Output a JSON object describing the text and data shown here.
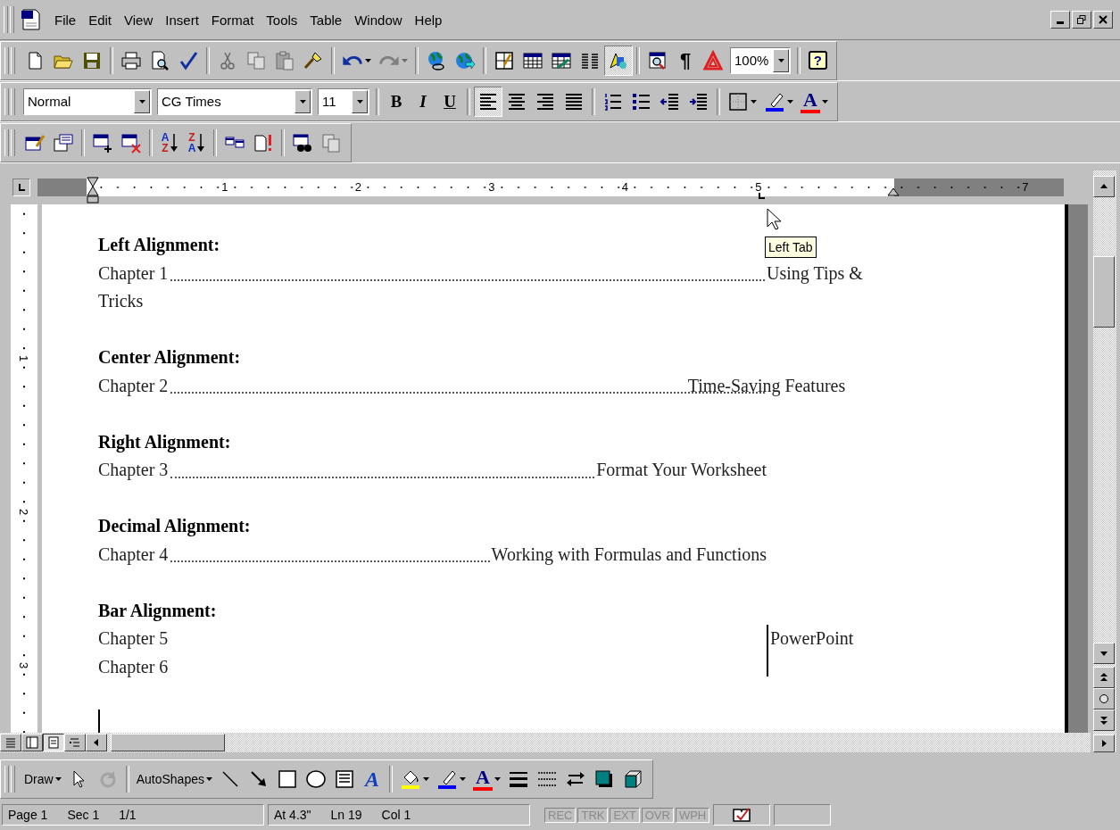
{
  "menu_bar": {
    "items": [
      "File",
      "Edit",
      "View",
      "Insert",
      "Format",
      "Tools",
      "Table",
      "Window",
      "Help"
    ]
  },
  "standard_toolbar": {
    "groups": [
      [
        {
          "kind": "new",
          "pressed": false,
          "disabled": false
        },
        {
          "kind": "open",
          "pressed": false,
          "disabled": false
        },
        {
          "kind": "save",
          "pressed": false,
          "disabled": false
        }
      ],
      [
        {
          "kind": "print",
          "pressed": false,
          "disabled": false
        },
        {
          "kind": "preview",
          "pressed": false,
          "disabled": false
        },
        {
          "kind": "spelling",
          "pressed": false,
          "disabled": false
        }
      ],
      [
        {
          "kind": "cut",
          "pressed": false,
          "disabled": true
        },
        {
          "kind": "copy",
          "pressed": false,
          "disabled": true
        },
        {
          "kind": "paste",
          "pressed": false,
          "disabled": true
        },
        {
          "kind": "painter",
          "pressed": false,
          "disabled": false
        }
      ],
      [
        {
          "kind": "undo",
          "pressed": false,
          "disabled": false,
          "dropdown": true
        },
        {
          "kind": "redo",
          "pressed": false,
          "disabled": true,
          "dropdown": true
        }
      ],
      [
        {
          "kind": "hyperlink",
          "pressed": false,
          "disabled": false
        },
        {
          "kind": "web",
          "pressed": false,
          "disabled": false
        }
      ],
      [
        {
          "kind": "tables-borders",
          "pressed": false,
          "disabled": false
        },
        {
          "kind": "insert-table",
          "pressed": false,
          "disabled": false
        },
        {
          "kind": "insert-sheet",
          "pressed": false,
          "disabled": false
        },
        {
          "kind": "columns",
          "pressed": false,
          "disabled": false
        },
        {
          "kind": "drawing",
          "pressed": true,
          "disabled": false
        }
      ],
      [
        {
          "kind": "document-map",
          "pressed": false,
          "disabled": false
        },
        {
          "kind": "show-formatting",
          "label": "¶",
          "pressed": false,
          "disabled": false
        },
        {
          "kind": "acrobat",
          "pressed": false,
          "disabled": false
        },
        {
          "kind": "zoom",
          "value": "100%"
        }
      ],
      [
        {
          "kind": "help",
          "label": "?",
          "pressed": false,
          "disabled": false
        }
      ]
    ]
  },
  "formatting_toolbar": {
    "style": "Normal",
    "font": "CG Times",
    "size": "11",
    "groups": [
      [
        {
          "kind": "bold",
          "label": "B",
          "pressed": false,
          "disabled": false
        },
        {
          "kind": "italic",
          "label": "I",
          "pressed": false,
          "disabled": false
        },
        {
          "kind": "underline",
          "label": "U",
          "pressed": false,
          "disabled": false
        }
      ],
      [
        {
          "kind": "align-left",
          "pressed": true,
          "disabled": false
        },
        {
          "kind": "align-center",
          "pressed": false,
          "disabled": false
        },
        {
          "kind": "align-right",
          "pressed": false,
          "disabled": false
        },
        {
          "kind": "justify",
          "pressed": false,
          "disabled": false
        }
      ],
      [
        {
          "kind": "numbering",
          "pressed": false,
          "disabled": false
        },
        {
          "kind": "bullets",
          "pressed": false,
          "disabled": false
        },
        {
          "kind": "outdent",
          "pressed": false,
          "disabled": false
        },
        {
          "kind": "indent",
          "pressed": false,
          "disabled": false
        }
      ],
      [
        {
          "kind": "borders",
          "pressed": false,
          "disabled": false,
          "dropdown": true
        },
        {
          "kind": "highlight",
          "pressed": false,
          "disabled": false,
          "dropdown": true
        },
        {
          "kind": "font-color",
          "label": "A",
          "pressed": false,
          "disabled": false,
          "dropdown": true
        }
      ]
    ]
  },
  "database_toolbar": {
    "groups": [
      [
        {
          "kind": "data-form",
          "pressed": false,
          "disabled": false
        },
        {
          "kind": "field-options",
          "pressed": false,
          "disabled": false
        }
      ],
      [
        {
          "kind": "add-record",
          "pressed": false,
          "disabled": false
        },
        {
          "kind": "delete-record",
          "pressed": false,
          "disabled": false
        }
      ],
      [
        {
          "kind": "sort-asc",
          "labels": [
            "A",
            "Z"
          ],
          "pressed": false,
          "disabled": false
        },
        {
          "kind": "sort-desc",
          "labels": [
            "Z",
            "A"
          ],
          "pressed": false,
          "disabled": false
        }
      ],
      [
        {
          "kind": "insert-database",
          "pressed": false,
          "disabled": false
        },
        {
          "kind": "update-field",
          "pressed": false,
          "disabled": false
        }
      ],
      [
        {
          "kind": "find-record",
          "pressed": false,
          "disabled": false
        },
        {
          "kind": "mail-merge",
          "pressed": false,
          "disabled": true
        }
      ]
    ]
  },
  "ruler": {
    "marks": [
      {
        "kind": "number",
        "label": "1"
      },
      {
        "kind": "number",
        "label": "2"
      },
      {
        "kind": "number",
        "label": "3"
      },
      {
        "kind": "number",
        "label": "4"
      },
      {
        "kind": "tabstop",
        "label": "5"
      },
      {
        "kind": "right-indent"
      },
      {
        "kind": "number",
        "label": "7"
      }
    ]
  },
  "vertical_ruler": {
    "marks": [
      "1",
      "2",
      "3"
    ]
  },
  "tooltip": "Left Tab",
  "document": {
    "sections": [
      {
        "heading": "Left Alignment:",
        "kind": "left",
        "entries": [
          {
            "text": "Chapter 1",
            "leader": true,
            "tab_text": "Using Tips &",
            "continuation": "Tricks"
          }
        ]
      },
      {
        "heading": "Center Alignment:",
        "kind": "center",
        "entries": [
          {
            "text": "Chapter 2",
            "leader": true,
            "tab_text": "Time-Saving Features"
          }
        ]
      },
      {
        "heading": "Right Alignment:",
        "kind": "right",
        "entries": [
          {
            "text": "Chapter 3",
            "leader": true,
            "tab_text": "Format Your Worksheet"
          }
        ]
      },
      {
        "heading": "Decimal Alignment:",
        "kind": "decimal",
        "entries": [
          {
            "text": "Chapter 4",
            "leader": true,
            "tab_text": "Working with Formulas and Functions"
          }
        ]
      },
      {
        "heading": "Bar Alignment:",
        "kind": "bar",
        "entries": [
          {
            "text": "Chapter 5",
            "leader": false,
            "tab_text": "PowerPoint"
          },
          {
            "text": "Chapter 6",
            "leader": false
          }
        ]
      }
    ]
  },
  "view_buttons": [
    {
      "kind": "normal",
      "selected": false
    },
    {
      "kind": "online",
      "selected": false
    },
    {
      "kind": "page",
      "selected": true
    },
    {
      "kind": "outline",
      "selected": false
    }
  ],
  "drawing_toolbar": {
    "items": [
      {
        "kind": "draw-menu",
        "label": "Draw",
        "pressed": false,
        "disabled": false,
        "dropdown": true
      },
      {
        "kind": "select",
        "pressed": false,
        "disabled": false
      },
      {
        "kind": "rotate",
        "pressed": false,
        "disabled": true
      },
      {
        "kind": "autoshapes",
        "label": "AutoShapes",
        "pressed": false,
        "disabled": false,
        "dropdown": true
      },
      {
        "kind": "line",
        "pressed": false,
        "disabled": false
      },
      {
        "kind": "arrow",
        "pressed": false,
        "disabled": false
      },
      {
        "kind": "rectangle",
        "pressed": false,
        "disabled": false
      },
      {
        "kind": "oval",
        "pressed": false,
        "disabled": false
      },
      {
        "kind": "textbox",
        "pressed": false,
        "disabled": false
      },
      {
        "kind": "wordart",
        "label": "A",
        "pressed": false,
        "disabled": false
      },
      {
        "kind": "fill-color",
        "pressed": false,
        "disabled": false,
        "dropdown": true
      },
      {
        "kind": "line-color",
        "pressed": false,
        "disabled": false,
        "dropdown": true
      },
      {
        "kind": "font-color",
        "label": "A",
        "pressed": false,
        "disabled": false,
        "dropdown": true
      },
      {
        "kind": "line-style",
        "pressed": false,
        "disabled": false
      },
      {
        "kind": "dash-style",
        "pressed": false,
        "disabled": false
      },
      {
        "kind": "arrow-style",
        "pressed": false,
        "disabled": false
      },
      {
        "kind": "shadow",
        "pressed": false,
        "disabled": false
      },
      {
        "kind": "extrusion",
        "pressed": false,
        "disabled": false
      }
    ]
  },
  "status_bar": {
    "position": [
      "Page 1",
      "Sec 1",
      "1/1"
    ],
    "cursor": [
      "At 4.3\"",
      "Ln 19",
      "Col 1"
    ],
    "indicators": [
      {
        "label": "REC",
        "disabled": true
      },
      {
        "label": "TRK",
        "disabled": true
      },
      {
        "label": "EXT",
        "disabled": true
      },
      {
        "label": "OVR",
        "disabled": true
      },
      {
        "label": "WPH",
        "disabled": true
      }
    ]
  }
}
